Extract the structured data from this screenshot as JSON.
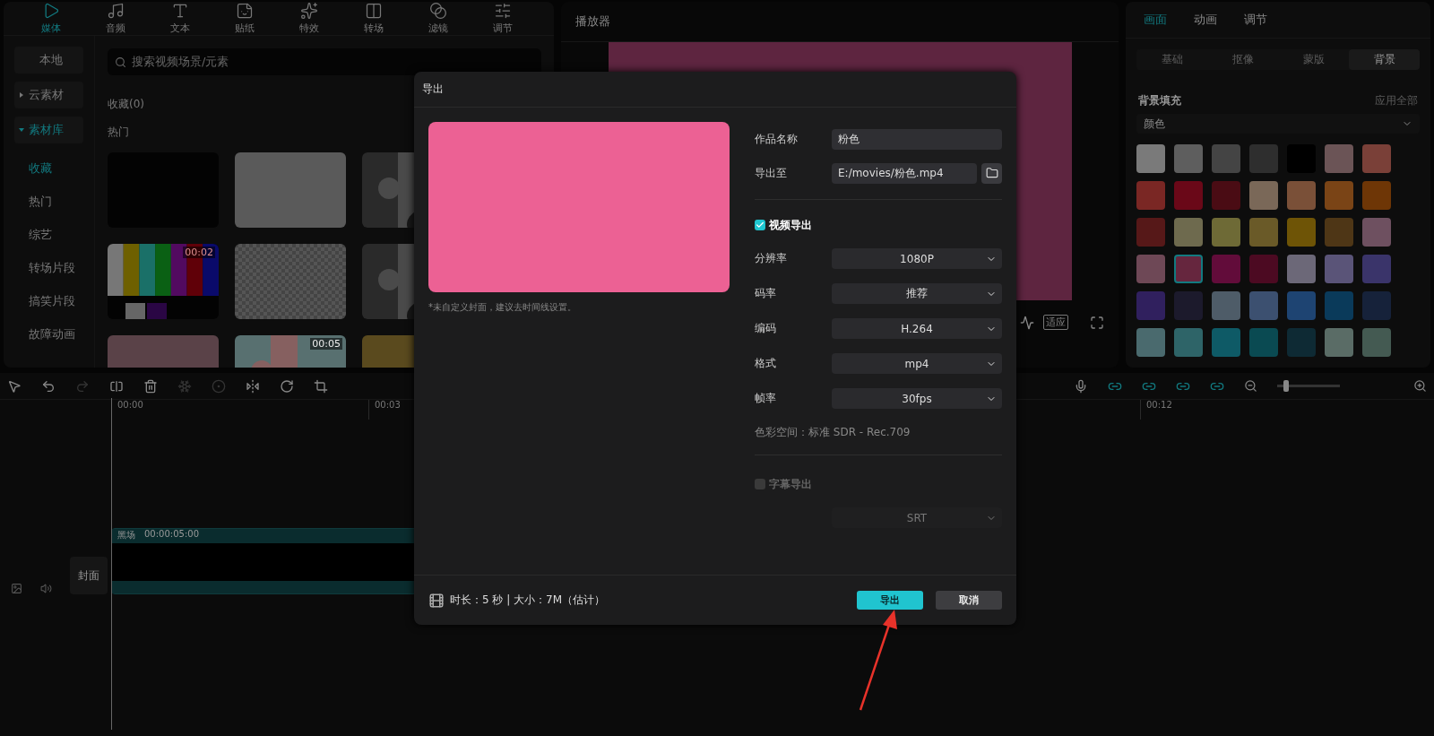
{
  "media_panel": {
    "tabs": [
      {
        "label": "媒体",
        "selected": true
      },
      {
        "label": "音频",
        "selected": false
      },
      {
        "label": "文本",
        "selected": false
      },
      {
        "label": "贴纸",
        "selected": false
      },
      {
        "label": "特效",
        "selected": false
      },
      {
        "label": "转场",
        "selected": false
      },
      {
        "label": "滤镜",
        "selected": false
      },
      {
        "label": "调节",
        "selected": false
      }
    ],
    "sidebar": [
      {
        "label": "本地",
        "kind": "group",
        "selected": false
      },
      {
        "label": "云素材",
        "kind": "folder",
        "expanded": false,
        "selected": false
      },
      {
        "label": "素材库",
        "kind": "folder",
        "expanded": true,
        "selected": true,
        "children": [
          {
            "label": "收藏",
            "selected": true
          },
          {
            "label": "热门",
            "selected": false
          },
          {
            "label": "综艺",
            "selected": false
          },
          {
            "label": "转场片段",
            "selected": false
          },
          {
            "label": "搞笑片段",
            "selected": false
          },
          {
            "label": "故障动画",
            "selected": false
          }
        ]
      }
    ],
    "search": {
      "placeholder": "搜索视频场景/元素"
    },
    "favorites_heading": "收藏(0)",
    "hot_heading": "热门",
    "thumbnails": [
      {
        "kind": "black"
      },
      {
        "kind": "gray"
      },
      {
        "kind": "picture"
      },
      {
        "kind": "colorbars",
        "duration": "00:02"
      },
      {
        "kind": "checker"
      },
      {
        "kind": "picture"
      },
      {
        "kind": "pink"
      },
      {
        "kind": "picture",
        "duration": "00:05"
      },
      {
        "kind": "yellow"
      }
    ]
  },
  "player": {
    "title": "播放器",
    "controls": [
      {
        "kind": "waveform"
      },
      {
        "label": "适应",
        "kind": "text"
      },
      {
        "kind": "fullscreen"
      }
    ]
  },
  "properties": {
    "tabs": [
      {
        "label": "画面",
        "selected": true
      },
      {
        "label": "动画",
        "selected": false
      },
      {
        "label": "调节",
        "selected": false
      }
    ],
    "subtabs": [
      {
        "label": "基础",
        "selected": false
      },
      {
        "label": "抠像",
        "selected": false
      },
      {
        "label": "蒙版",
        "selected": false
      },
      {
        "label": "背景",
        "selected": true
      }
    ],
    "section_title": "背景填充",
    "apply_all": "应用全部",
    "fill_type": "颜色",
    "swatches": [
      {
        "color": "#7a7a7a",
        "selected": false
      },
      {
        "color": "#5e5e5e",
        "selected": false
      },
      {
        "color": "#444444",
        "selected": false
      },
      {
        "color": "#2e2e2e",
        "selected": false
      },
      {
        "color": "#000000",
        "selected": false
      },
      {
        "color": "#6b5456",
        "selected": false
      },
      {
        "color": "#7a4038",
        "selected": false
      },
      {
        "color": "#7a2724",
        "selected": false
      },
      {
        "color": "#6a0818",
        "selected": false
      },
      {
        "color": "#4a0c14",
        "selected": false
      },
      {
        "color": "#7a6858",
        "selected": false
      },
      {
        "color": "#7a5038",
        "selected": false
      },
      {
        "color": "#7a4416",
        "selected": false
      },
      {
        "color": "#6e3606",
        "selected": false
      },
      {
        "color": "#561818",
        "selected": false
      },
      {
        "color": "#6e6a4e",
        "selected": false
      },
      {
        "color": "#6e6a36",
        "selected": false
      },
      {
        "color": "#6a5a28",
        "selected": false
      },
      {
        "color": "#6e5406",
        "selected": false
      },
      {
        "color": "#4e3616",
        "selected": false
      },
      {
        "color": "#6e5060",
        "selected": false
      },
      {
        "color": "#6e4856",
        "selected": false
      },
      {
        "color": "#66263e",
        "selected": true
      },
      {
        "color": "#620c3a",
        "selected": false
      },
      {
        "color": "#4c0a22",
        "selected": false
      },
      {
        "color": "#6c6878",
        "selected": false
      },
      {
        "color": "#5a5478",
        "selected": false
      },
      {
        "color": "#3a346a",
        "selected": false
      },
      {
        "color": "#30205e",
        "selected": false
      },
      {
        "color": "#1c1a2c",
        "selected": false
      },
      {
        "color": "#4e5c68",
        "selected": false
      },
      {
        "color": "#3c5070",
        "selected": false
      },
      {
        "color": "#1e4472",
        "selected": false
      },
      {
        "color": "#0a3a5a",
        "selected": false
      },
      {
        "color": "#16223a",
        "selected": false
      },
      {
        "color": "#4a6a6e",
        "selected": false
      },
      {
        "color": "#2e6468",
        "selected": false
      },
      {
        "color": "#0e5a66",
        "selected": false
      },
      {
        "color": "#0a4a52",
        "selected": false
      },
      {
        "color": "#0e2a34",
        "selected": false
      },
      {
        "color": "#5a6c66",
        "selected": false
      },
      {
        "color": "#445a52",
        "selected": false
      }
    ]
  },
  "timeline": {
    "tools": [
      {
        "disabled": false
      },
      {
        "disabled": false
      },
      {
        "disabled": true
      },
      {
        "disabled": false
      },
      {
        "disabled": false
      },
      {
        "disabled": true
      },
      {
        "disabled": true
      },
      {
        "disabled": false
      },
      {
        "disabled": false
      },
      {
        "disabled": false
      }
    ],
    "zoom": {
      "level": 0.1
    },
    "ruler": [
      "00:00",
      "00:03",
      "00:12"
    ],
    "track": {
      "cover_label": "封面",
      "clip_name": "黑场",
      "clip_duration": "00:00:05:00"
    }
  },
  "dialog": {
    "title": "导出",
    "note": "*未自定义封面，建议去时间线设置。",
    "name_label": "作品名称",
    "name_value": "粉色",
    "path_label": "导出至",
    "path_value": "E:/movies/粉色.mp4",
    "video_export": {
      "label": "视频导出",
      "checked": true
    },
    "settings": [
      {
        "label": "分辨率",
        "value": "1080P"
      },
      {
        "label": "码率",
        "value": "推荐"
      },
      {
        "label": "编码",
        "value": "H.264"
      },
      {
        "label": "格式",
        "value": "mp4"
      },
      {
        "label": "帧率",
        "value": "30fps"
      }
    ],
    "color_space": "色彩空间：标准 SDR - Rec.709",
    "subtitle_export": {
      "label": "字幕导出",
      "checked": false,
      "disabled": true
    },
    "subtitle_format": {
      "value": "SRT",
      "disabled": true
    },
    "summary": "时长：5 秒 | 大小：7M（估计）",
    "buttons": [
      {
        "label": "导出",
        "primary": true
      },
      {
        "label": "取消",
        "primary": false
      }
    ]
  }
}
